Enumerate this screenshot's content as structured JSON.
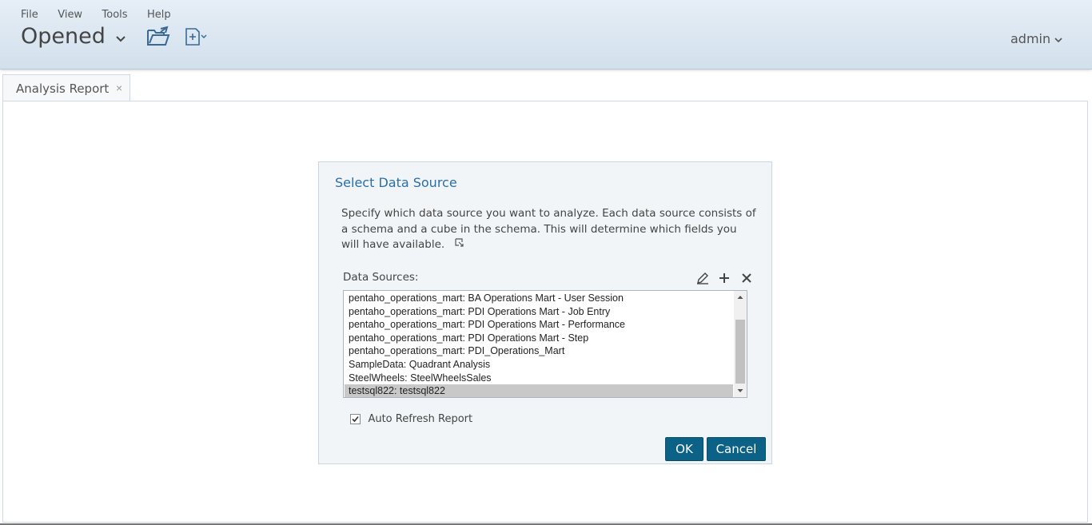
{
  "menu": [
    "File",
    "View",
    "Tools",
    "Help"
  ],
  "header": {
    "perspective": "Opened",
    "user": "admin"
  },
  "icons": {
    "perspective_chevron": "chevron-down-icon",
    "open_folder": "folder-open-icon",
    "new_file": "new-file-icon",
    "user_chevron": "chevron-down-icon"
  },
  "tab": {
    "label": "Analysis Report",
    "close": "×"
  },
  "dialog": {
    "title": "Select Data Source",
    "description": "Specify which data source you want to analyze. Each data source consists of a schema and a cube in the schema. This will determine which fields you will have available.",
    "data_sources_label": "Data Sources:",
    "items": [
      "pentaho_operations_mart: BA Operations Mart - User Session",
      "pentaho_operations_mart: PDI Operations Mart - Job Entry",
      "pentaho_operations_mart: PDI Operations Mart - Performance",
      "pentaho_operations_mart: PDI Operations Mart - Step",
      "pentaho_operations_mart: PDI_Operations_Mart",
      "SampleData: Quadrant Analysis",
      "SteelWheels: SteelWheelsSales",
      "testsql822: testsql822"
    ],
    "selected_index": 7,
    "auto_refresh_label": "Auto Refresh Report",
    "auto_refresh_checked": true,
    "ok_label": "OK",
    "cancel_label": "Cancel"
  },
  "colors": {
    "header_bg": "#d8e4ef",
    "title_blue": "#2a6fa8",
    "button_bg": "#0b6286",
    "selected_row": "#c8c8c8"
  }
}
